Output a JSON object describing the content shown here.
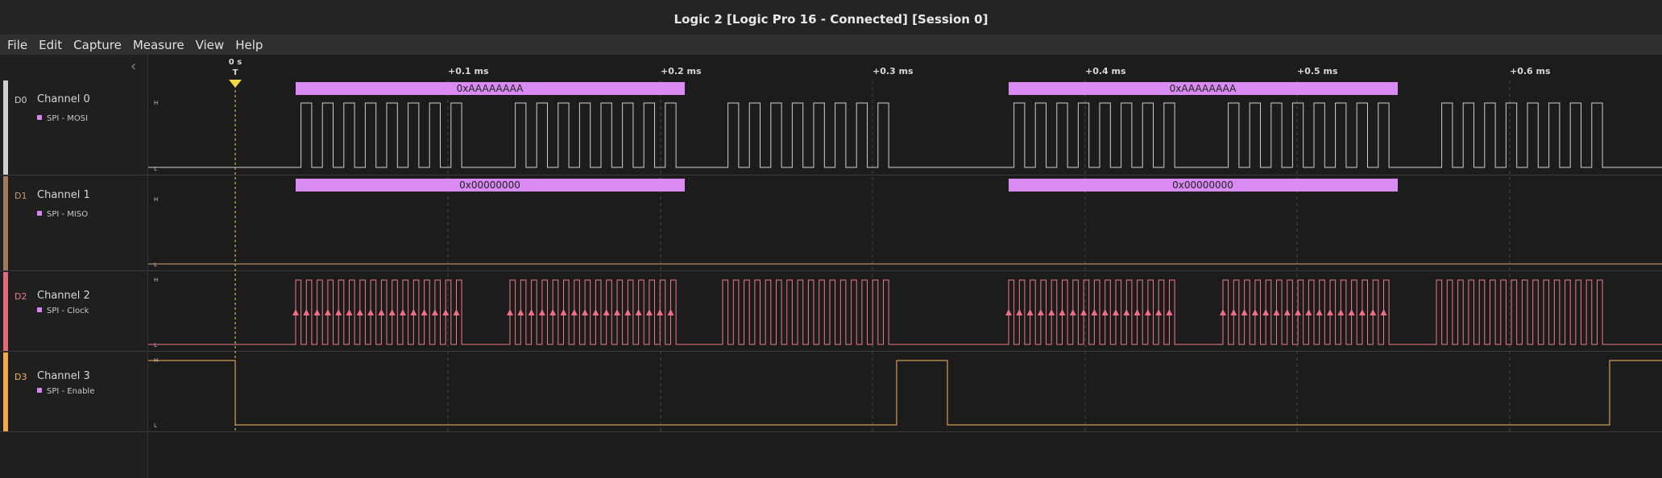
{
  "window": {
    "title": "Logic 2 [Logic Pro 16 - Connected] [Session 0]"
  },
  "menu": [
    "File",
    "Edit",
    "Capture",
    "Measure",
    "View",
    "Help"
  ],
  "timeline": {
    "trigger_label": "0 s",
    "trigger_marker": "T",
    "ticks": [
      "+0.1 ms",
      "+0.2 ms",
      "+0.3 ms",
      "+0.4 ms",
      "+0.5 ms",
      "+0.6 ms"
    ]
  },
  "channels": [
    {
      "id": "D0",
      "name": "Channel 0",
      "analyzer": "SPI - MOSI",
      "color": "#cfcfcf",
      "id_color": "#cfcfcf",
      "high": "H",
      "low": "L",
      "frames": [
        {
          "text": "0xAAAAAAAA"
        },
        {
          "text": "0xAAAAAAAA"
        }
      ]
    },
    {
      "id": "D1",
      "name": "Channel 1",
      "analyzer": "SPI - MISO",
      "color": "#d8a878",
      "id_color": "#c89870",
      "high": "H",
      "low": "L",
      "frames": [
        {
          "text": "0x00000000"
        },
        {
          "text": "0x00000000"
        }
      ]
    },
    {
      "id": "D2",
      "name": "Channel 2",
      "analyzer": "SPI - Clock",
      "color": "#f07a8c",
      "id_color": "#f07a8c",
      "high": "H",
      "low": "L",
      "frames": []
    },
    {
      "id": "D3",
      "name": "Channel 3",
      "analyzer": "SPI - Enable",
      "color": "#f8b860",
      "id_color": "#f8b860",
      "high": "H",
      "low": "L",
      "frames": []
    }
  ],
  "colors": {
    "frame_fill": "#d98bf2",
    "clock_marker": "#f06f86",
    "trigger": "#f5d742",
    "grid": "#444444"
  }
}
